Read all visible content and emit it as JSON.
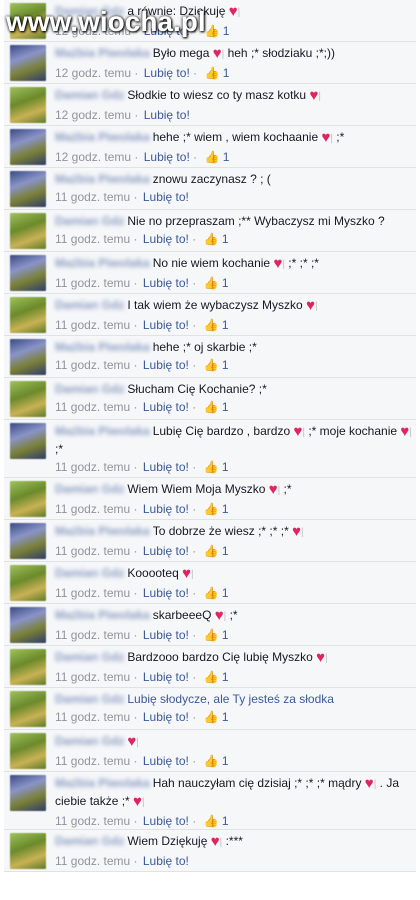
{
  "watermark": "www.wiocha.pl",
  "like_label": "Lubię to!",
  "comments": [
    {
      "author": "Damian Gdz",
      "avatar": "damian",
      "text": "a równie: Dziękuję",
      "heart": true,
      "extra": "",
      "time": "12 godz. temu",
      "likes": "1",
      "tall": false,
      "link": false
    },
    {
      "author": "Mażbia Piwolaka",
      "avatar": "malzia",
      "text": "Było mega",
      "heart": true,
      "extra": "heh ;* słodziaku ;*;))",
      "time": "12 godz. temu",
      "likes": "1",
      "tall": false,
      "link": false
    },
    {
      "author": "Damian Gdz",
      "avatar": "damian",
      "text": "Słodkie to wiesz co ty masz kotku",
      "heart": true,
      "extra": "",
      "time": "12 godz. temu",
      "likes": "",
      "tall": false,
      "link": false
    },
    {
      "author": "Mażbia Piwolaka",
      "avatar": "malzia",
      "text": "hehe ;* wiem , wiem kochaanie",
      "heart": true,
      "extra": ";*",
      "time": "12 godz. temu",
      "likes": "1",
      "tall": false,
      "link": false
    },
    {
      "author": "Mażbia Piwolaka",
      "avatar": "malzia",
      "text": "znowu zaczynasz ? ; (",
      "heart": false,
      "extra": "",
      "time": "11 godz. temu",
      "likes": "",
      "tall": false,
      "link": false
    },
    {
      "author": "Damian Gdz",
      "avatar": "damian",
      "text": "Nie no przepraszam ;** Wybaczysz mi Myszko ?",
      "heart": false,
      "extra": "",
      "time": "11 godz. temu",
      "likes": "1",
      "tall": false,
      "link": false
    },
    {
      "author": "Mażbia Piwolaka",
      "avatar": "malzia",
      "text": "No nie wiem kochanie",
      "heart": true,
      "extra": ";* ;* ;*",
      "time": "11 godz. temu",
      "likes": "1",
      "tall": false,
      "link": false
    },
    {
      "author": "Damian Gdz",
      "avatar": "damian",
      "text": "I tak wiem że wybaczysz Myszko",
      "heart": true,
      "extra": "",
      "time": "11 godz. temu",
      "likes": "1",
      "tall": false,
      "link": false
    },
    {
      "author": "Mażbia Piwolaka",
      "avatar": "malzia",
      "text": "hehe ;* oj skarbie ;*",
      "heart": false,
      "extra": "",
      "time": "11 godz. temu",
      "likes": "1",
      "tall": false,
      "link": false
    },
    {
      "author": "Damian Gdz",
      "avatar": "damian",
      "text": "Słucham Cię Kochanie? ;*",
      "heart": false,
      "extra": "",
      "time": "11 godz. temu",
      "likes": "1",
      "tall": false,
      "link": false
    },
    {
      "author": "Mażbia Piwolaka",
      "avatar": "malzia",
      "text": "Lubię Cię bardzo , bardzo",
      "heart": true,
      "extra": ";* moje kochanie",
      "heart2": true,
      "extra2": ";*",
      "time": "11 godz. temu",
      "likes": "1",
      "tall": true,
      "link": false
    },
    {
      "author": "Damian Gdz",
      "avatar": "damian",
      "text": "Wiem Wiem Moja Myszko",
      "heart": true,
      "extra": ";*",
      "time": "11 godz. temu",
      "likes": "1",
      "tall": false,
      "link": false
    },
    {
      "author": "Mażbia Piwolaka",
      "avatar": "malzia",
      "text": "To dobrze że wiesz ;* ;* ;*",
      "heart": true,
      "extra": "",
      "time": "11 godz. temu",
      "likes": "1",
      "tall": false,
      "link": false
    },
    {
      "author": "Damian Gdz",
      "avatar": "damian",
      "text": "Kooooteq",
      "heart": true,
      "extra": "",
      "time": "11 godz. temu",
      "likes": "1",
      "tall": false,
      "link": false
    },
    {
      "author": "Mażbia Piwolaka",
      "avatar": "malzia",
      "text": "skarbeeeQ",
      "heart": true,
      "extra": ";*",
      "time": "11 godz. temu",
      "likes": "1",
      "tall": false,
      "link": false
    },
    {
      "author": "Damian Gdz",
      "avatar": "damian",
      "text": "Bardzooo bardzo Cię lubię Myszko",
      "heart": true,
      "extra": "",
      "time": "11 godz. temu",
      "likes": "1",
      "tall": false,
      "link": false
    },
    {
      "author": "Damian Gdz",
      "avatar": "damian",
      "text": "Lubię słodycze, ale Ty jesteś za słodka",
      "heart": false,
      "extra": "",
      "time": "11 godz. temu",
      "likes": "1",
      "tall": false,
      "link": true
    },
    {
      "author": "Damian Gdz",
      "avatar": "damian",
      "text": "",
      "heart": true,
      "extra": "",
      "time": "11 godz. temu",
      "likes": "1",
      "tall": false,
      "link": false
    },
    {
      "author": "Mażbia Piwolaka",
      "avatar": "malzia",
      "text": "Hah nauczyłam cię dzisiaj ;* ;* ;* mądry",
      "heart": true,
      "extra": ". Ja ciebie także ;*",
      "heart2": true,
      "extra2": "",
      "time": "11 godz. temu",
      "likes": "1",
      "tall": true,
      "link": false
    },
    {
      "author": "Damian Gdz",
      "avatar": "damian",
      "text": "Wiem Dziękuję",
      "heart": true,
      "extra": ":***",
      "time": "11 godz. temu",
      "likes": "",
      "tall": false,
      "link": false
    }
  ]
}
